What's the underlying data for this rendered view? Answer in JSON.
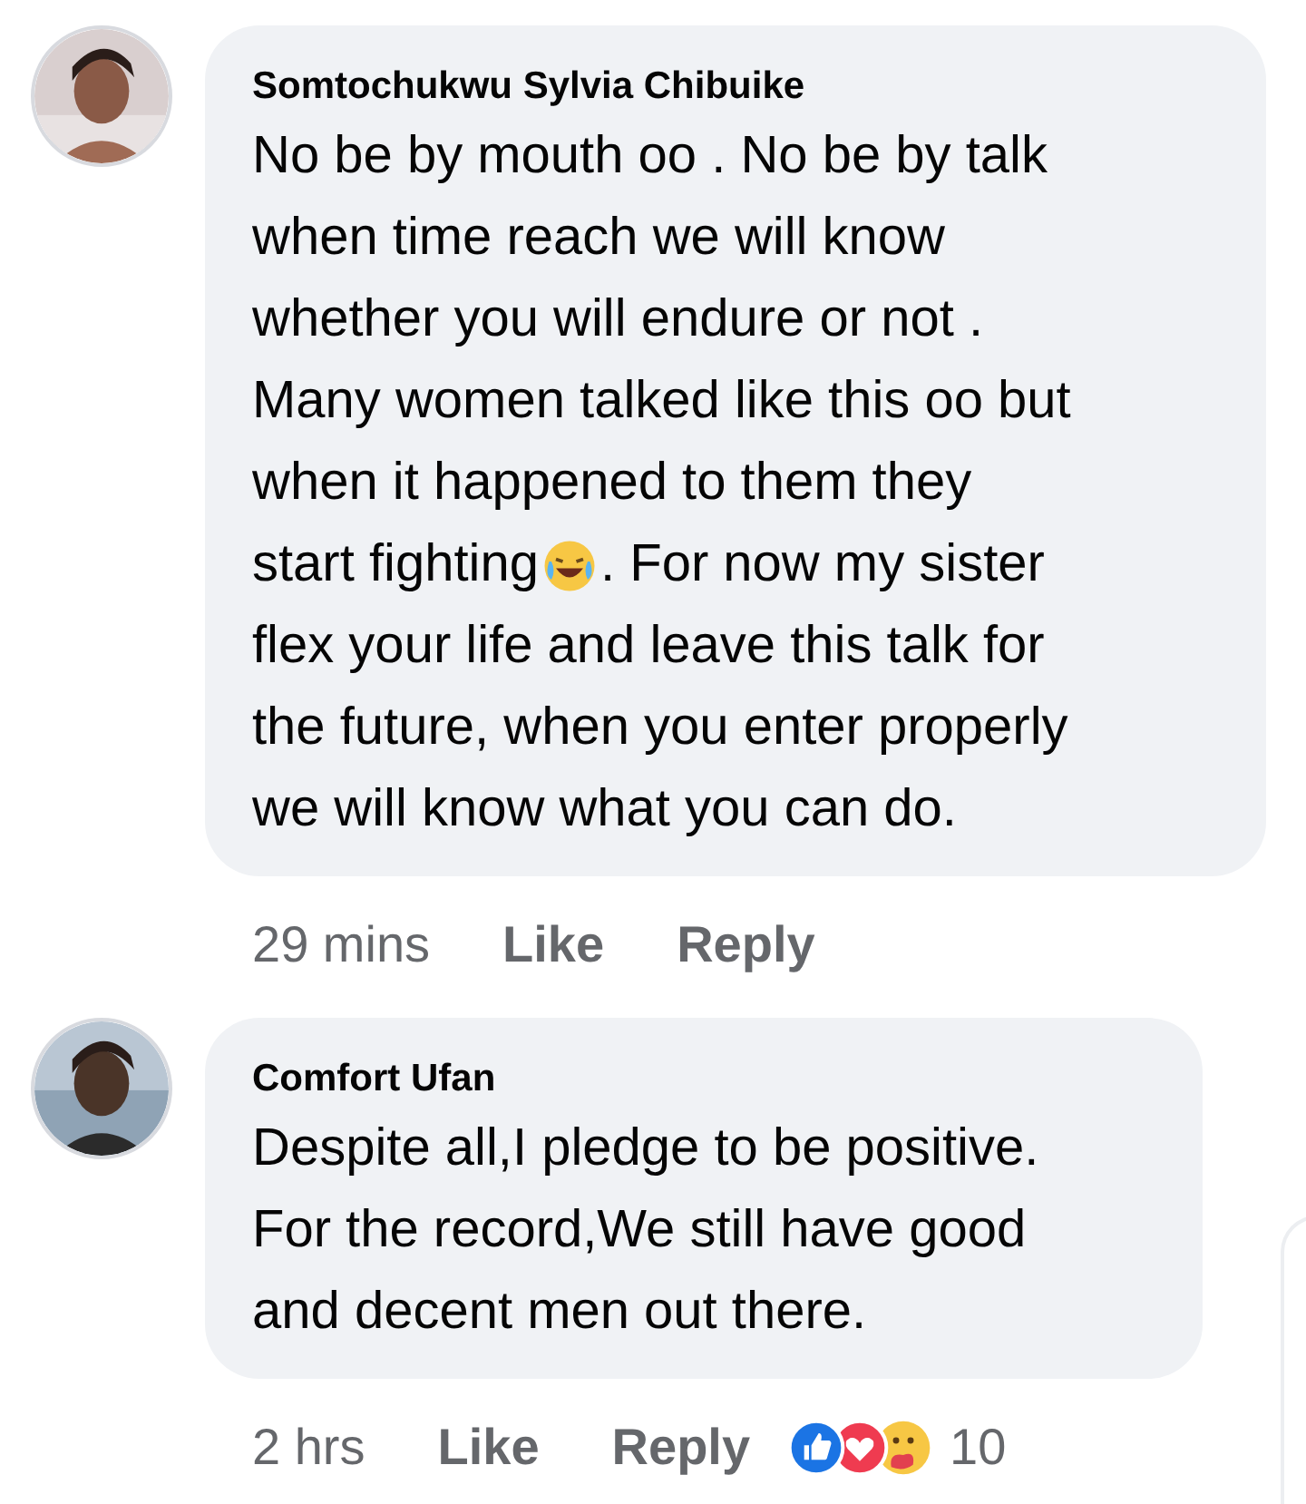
{
  "comments": [
    {
      "author": "Somtochukwu Sylvia Chibuike",
      "lines": [
        [
          "No be by mouth oo . No be by talk"
        ],
        [
          "when time reach we will know"
        ],
        [
          "whether you will endure or not ."
        ],
        [
          "Many women talked like this oo but"
        ],
        [
          "when it happened to them they"
        ],
        [
          "start fighting",
          ". For now my sister"
        ],
        [
          "flex your life and leave this talk for"
        ],
        [
          "the future, when you enter properly"
        ],
        [
          "we will know what you can do."
        ]
      ],
      "time": "29 mins",
      "like": "Like",
      "reply": "Reply"
    },
    {
      "author": "Comfort Ufan",
      "lines": [
        [
          "Despite all,I pledge to be positive."
        ],
        [
          "For the record,We still have good"
        ],
        [
          "and decent men out there."
        ]
      ],
      "time": "2 hrs",
      "like": "Like",
      "reply": "Reply",
      "reaction_count": "10"
    }
  ]
}
